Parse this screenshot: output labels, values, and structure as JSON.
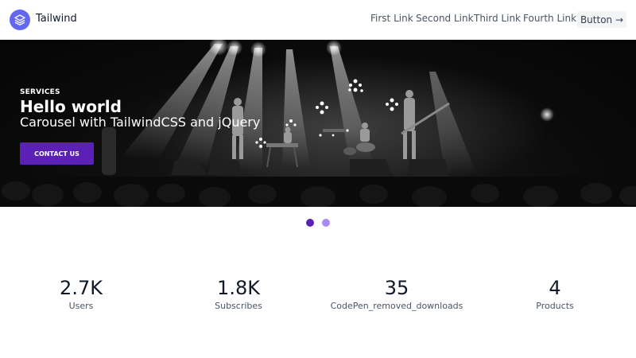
{
  "header": {
    "brand": "Tailwind",
    "logo_icon": "layers-icon",
    "nav_links": [
      "First Link",
      "Second Link",
      "Third Link",
      "Fourth Link"
    ],
    "button_label": "Button →"
  },
  "hero": {
    "eyebrow": "SERVICES",
    "title": "Hello world",
    "subtitle": "Carousel with TailwindCSS and jQuery",
    "cta_label": "CONTACT US",
    "image": "concert-stage-photo",
    "accent_color": "#5b21b6"
  },
  "carousel": {
    "slide_count": 2,
    "active_index": 0,
    "active_color": "#5b21b6",
    "inactive_color": "#a78bfa"
  },
  "stats": [
    {
      "value": "2.7K",
      "label": "Users"
    },
    {
      "value": "1.8K",
      "label": "Subscribes"
    },
    {
      "value": "35",
      "label": "CodePen_removed_downloads"
    },
    {
      "value": "4",
      "label": "Products"
    }
  ]
}
